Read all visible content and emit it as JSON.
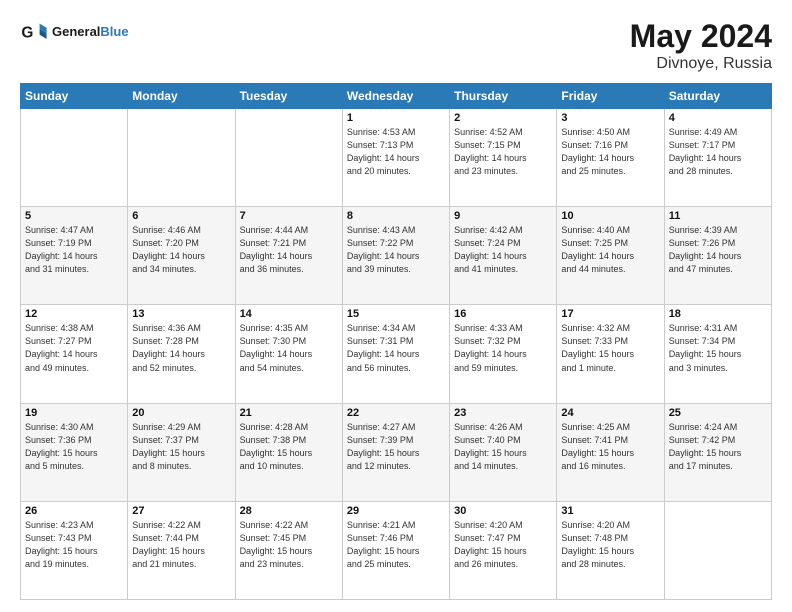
{
  "header": {
    "logo_general": "General",
    "logo_blue": "Blue",
    "month_year": "May 2024",
    "location": "Divnoye, Russia"
  },
  "weekdays": [
    "Sunday",
    "Monday",
    "Tuesday",
    "Wednesday",
    "Thursday",
    "Friday",
    "Saturday"
  ],
  "weeks": [
    [
      {
        "day": "",
        "info": ""
      },
      {
        "day": "",
        "info": ""
      },
      {
        "day": "",
        "info": ""
      },
      {
        "day": "1",
        "info": "Sunrise: 4:53 AM\nSunset: 7:13 PM\nDaylight: 14 hours\nand 20 minutes."
      },
      {
        "day": "2",
        "info": "Sunrise: 4:52 AM\nSunset: 7:15 PM\nDaylight: 14 hours\nand 23 minutes."
      },
      {
        "day": "3",
        "info": "Sunrise: 4:50 AM\nSunset: 7:16 PM\nDaylight: 14 hours\nand 25 minutes."
      },
      {
        "day": "4",
        "info": "Sunrise: 4:49 AM\nSunset: 7:17 PM\nDaylight: 14 hours\nand 28 minutes."
      }
    ],
    [
      {
        "day": "5",
        "info": "Sunrise: 4:47 AM\nSunset: 7:19 PM\nDaylight: 14 hours\nand 31 minutes."
      },
      {
        "day": "6",
        "info": "Sunrise: 4:46 AM\nSunset: 7:20 PM\nDaylight: 14 hours\nand 34 minutes."
      },
      {
        "day": "7",
        "info": "Sunrise: 4:44 AM\nSunset: 7:21 PM\nDaylight: 14 hours\nand 36 minutes."
      },
      {
        "day": "8",
        "info": "Sunrise: 4:43 AM\nSunset: 7:22 PM\nDaylight: 14 hours\nand 39 minutes."
      },
      {
        "day": "9",
        "info": "Sunrise: 4:42 AM\nSunset: 7:24 PM\nDaylight: 14 hours\nand 41 minutes."
      },
      {
        "day": "10",
        "info": "Sunrise: 4:40 AM\nSunset: 7:25 PM\nDaylight: 14 hours\nand 44 minutes."
      },
      {
        "day": "11",
        "info": "Sunrise: 4:39 AM\nSunset: 7:26 PM\nDaylight: 14 hours\nand 47 minutes."
      }
    ],
    [
      {
        "day": "12",
        "info": "Sunrise: 4:38 AM\nSunset: 7:27 PM\nDaylight: 14 hours\nand 49 minutes."
      },
      {
        "day": "13",
        "info": "Sunrise: 4:36 AM\nSunset: 7:28 PM\nDaylight: 14 hours\nand 52 minutes."
      },
      {
        "day": "14",
        "info": "Sunrise: 4:35 AM\nSunset: 7:30 PM\nDaylight: 14 hours\nand 54 minutes."
      },
      {
        "day": "15",
        "info": "Sunrise: 4:34 AM\nSunset: 7:31 PM\nDaylight: 14 hours\nand 56 minutes."
      },
      {
        "day": "16",
        "info": "Sunrise: 4:33 AM\nSunset: 7:32 PM\nDaylight: 14 hours\nand 59 minutes."
      },
      {
        "day": "17",
        "info": "Sunrise: 4:32 AM\nSunset: 7:33 PM\nDaylight: 15 hours\nand 1 minute."
      },
      {
        "day": "18",
        "info": "Sunrise: 4:31 AM\nSunset: 7:34 PM\nDaylight: 15 hours\nand 3 minutes."
      }
    ],
    [
      {
        "day": "19",
        "info": "Sunrise: 4:30 AM\nSunset: 7:36 PM\nDaylight: 15 hours\nand 5 minutes."
      },
      {
        "day": "20",
        "info": "Sunrise: 4:29 AM\nSunset: 7:37 PM\nDaylight: 15 hours\nand 8 minutes."
      },
      {
        "day": "21",
        "info": "Sunrise: 4:28 AM\nSunset: 7:38 PM\nDaylight: 15 hours\nand 10 minutes."
      },
      {
        "day": "22",
        "info": "Sunrise: 4:27 AM\nSunset: 7:39 PM\nDaylight: 15 hours\nand 12 minutes."
      },
      {
        "day": "23",
        "info": "Sunrise: 4:26 AM\nSunset: 7:40 PM\nDaylight: 15 hours\nand 14 minutes."
      },
      {
        "day": "24",
        "info": "Sunrise: 4:25 AM\nSunset: 7:41 PM\nDaylight: 15 hours\nand 16 minutes."
      },
      {
        "day": "25",
        "info": "Sunrise: 4:24 AM\nSunset: 7:42 PM\nDaylight: 15 hours\nand 17 minutes."
      }
    ],
    [
      {
        "day": "26",
        "info": "Sunrise: 4:23 AM\nSunset: 7:43 PM\nDaylight: 15 hours\nand 19 minutes."
      },
      {
        "day": "27",
        "info": "Sunrise: 4:22 AM\nSunset: 7:44 PM\nDaylight: 15 hours\nand 21 minutes."
      },
      {
        "day": "28",
        "info": "Sunrise: 4:22 AM\nSunset: 7:45 PM\nDaylight: 15 hours\nand 23 minutes."
      },
      {
        "day": "29",
        "info": "Sunrise: 4:21 AM\nSunset: 7:46 PM\nDaylight: 15 hours\nand 25 minutes."
      },
      {
        "day": "30",
        "info": "Sunrise: 4:20 AM\nSunset: 7:47 PM\nDaylight: 15 hours\nand 26 minutes."
      },
      {
        "day": "31",
        "info": "Sunrise: 4:20 AM\nSunset: 7:48 PM\nDaylight: 15 hours\nand 28 minutes."
      },
      {
        "day": "",
        "info": ""
      }
    ]
  ]
}
